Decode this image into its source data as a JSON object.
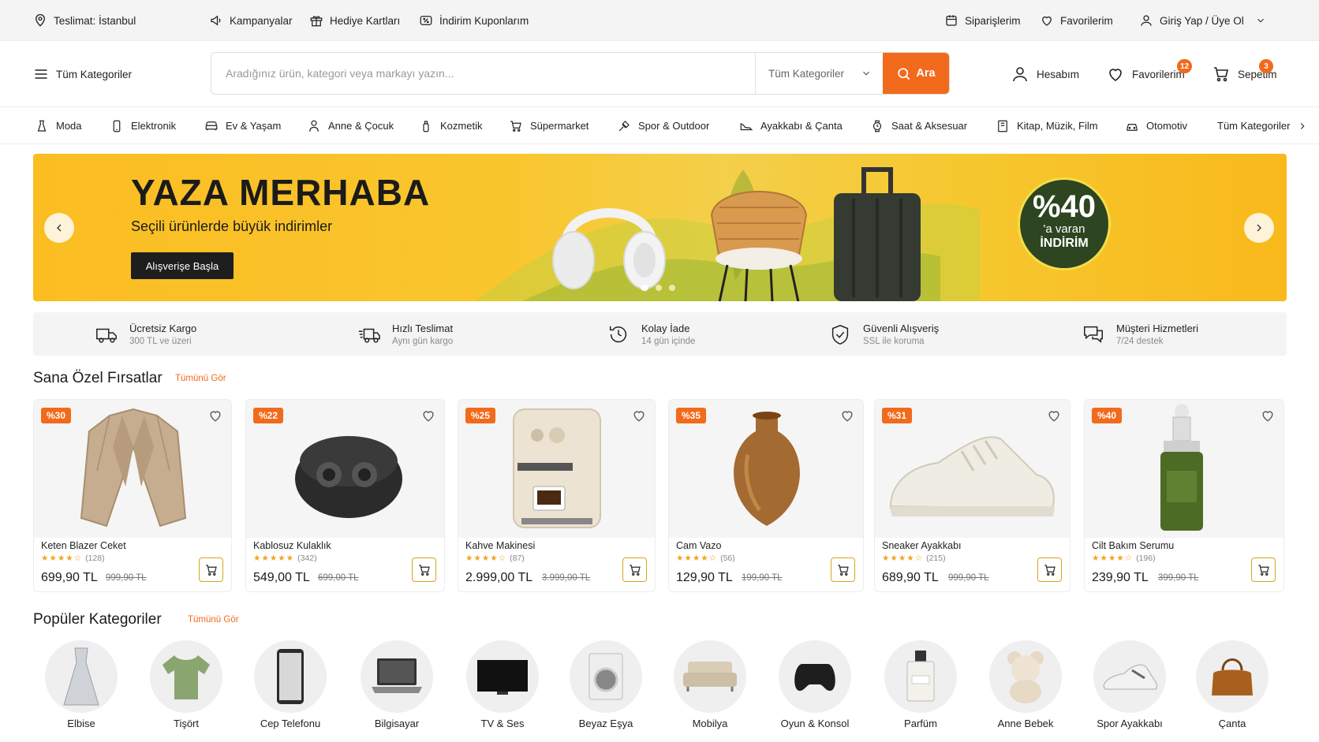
{
  "topbar": {
    "delivery": "Teslimat: İstanbul",
    "campaigns": "Kampanyalar",
    "giftcards": "Hediye Kartları",
    "coupons": "İndirim Kuponlarım",
    "orders": "Siparişlerim",
    "favorites": "Favorilerim",
    "login": "Giriş Yap / Üye Ol"
  },
  "header": {
    "all_categories": "Tüm Kategoriler",
    "search_placeholder": "Aradığınız ürün, kategori veya markayı yazın...",
    "category_select": "Tüm Kategoriler",
    "search_button": "Ara",
    "account": "Hesabım",
    "favorites": "Favorilerim",
    "favorites_count": "12",
    "cart": "Sepetim",
    "cart_count": "3"
  },
  "catnav": [
    "Moda",
    "Elektronik",
    "Ev & Yaşam",
    "Anne & Çocuk",
    "Kozmetik",
    "Süpermarket",
    "Spor & Outdoor",
    "Ayakkabı & Çanta",
    "Saat & Aksesuar",
    "Kitap, Müzik, Film",
    "Otomotiv",
    "Tüm Kategoriler"
  ],
  "banner": {
    "title": "YAZA MERHABA",
    "subtitle": "Seçili ürünlerde büyük indirimler",
    "button": "Alışverişe Başla",
    "discount_big": "%40",
    "discount_mid": "'a varan",
    "discount_small": "İNDİRİM",
    "active_slide": 1,
    "slide_count": 3
  },
  "features": [
    {
      "title": "Ücretsiz Kargo",
      "sub": "300 TL ve üzeri",
      "icon": "truck-icon"
    },
    {
      "title": "Hızlı Teslimat",
      "sub": "Aynı gün kargo",
      "icon": "fast-truck-icon"
    },
    {
      "title": "Kolay İade",
      "sub": "14 gün içinde",
      "icon": "return-clock-icon"
    },
    {
      "title": "Güvenli Alışveriş",
      "sub": "SSL ile koruma",
      "icon": "secure-basket-icon"
    },
    {
      "title": "Müşteri Hizmetleri",
      "sub": "7/24 destek",
      "icon": "chat-icon"
    }
  ],
  "deals": {
    "title": "Sana Özel Fırsatlar",
    "link": "Tümünü Gör",
    "products": [
      {
        "name": "Keten Blazer Ceket",
        "discount": "%30",
        "rating": "★★★★☆",
        "reviews": "(128)",
        "price": "699,90 TL",
        "old": "999,90 TL"
      },
      {
        "name": "Kablosuz Kulaklık",
        "discount": "%22",
        "rating": "★★★★★",
        "reviews": "(342)",
        "price": "549,00 TL",
        "old": "699,00 TL"
      },
      {
        "name": "Kahve Makinesi",
        "discount": "%25",
        "rating": "★★★★☆",
        "reviews": "(87)",
        "price": "2.999,00 TL",
        "old": "3.999,00 TL"
      },
      {
        "name": "Cam Vazo",
        "discount": "%35",
        "rating": "★★★★☆",
        "reviews": "(56)",
        "price": "129,90 TL",
        "old": "199,90 TL"
      },
      {
        "name": "Sneaker Ayakkabı",
        "discount": "%31",
        "rating": "★★★★☆",
        "reviews": "(215)",
        "price": "689,90 TL",
        "old": "999,90 TL"
      },
      {
        "name": "Cilt Bakım Serumu",
        "discount": "%40",
        "rating": "★★★★☆",
        "reviews": "(196)",
        "price": "239,90 TL",
        "old": "399,90 TL"
      }
    ]
  },
  "popular": {
    "title": "Popüler Kategoriler",
    "link": "Tümünü Gör",
    "items": [
      "Elbise",
      "Tişört",
      "Cep Telefonu",
      "Bilgisayar",
      "TV & Ses",
      "Beyaz Eşya",
      "Mobilya",
      "Oyun & Konsol",
      "Parfüm",
      "Anne Bebek",
      "Spor Ayakkabı",
      "Çanta"
    ]
  },
  "colors": {
    "accent": "#f26a1b",
    "banner": "#f9c62e",
    "cart_border": "#d6a520"
  }
}
